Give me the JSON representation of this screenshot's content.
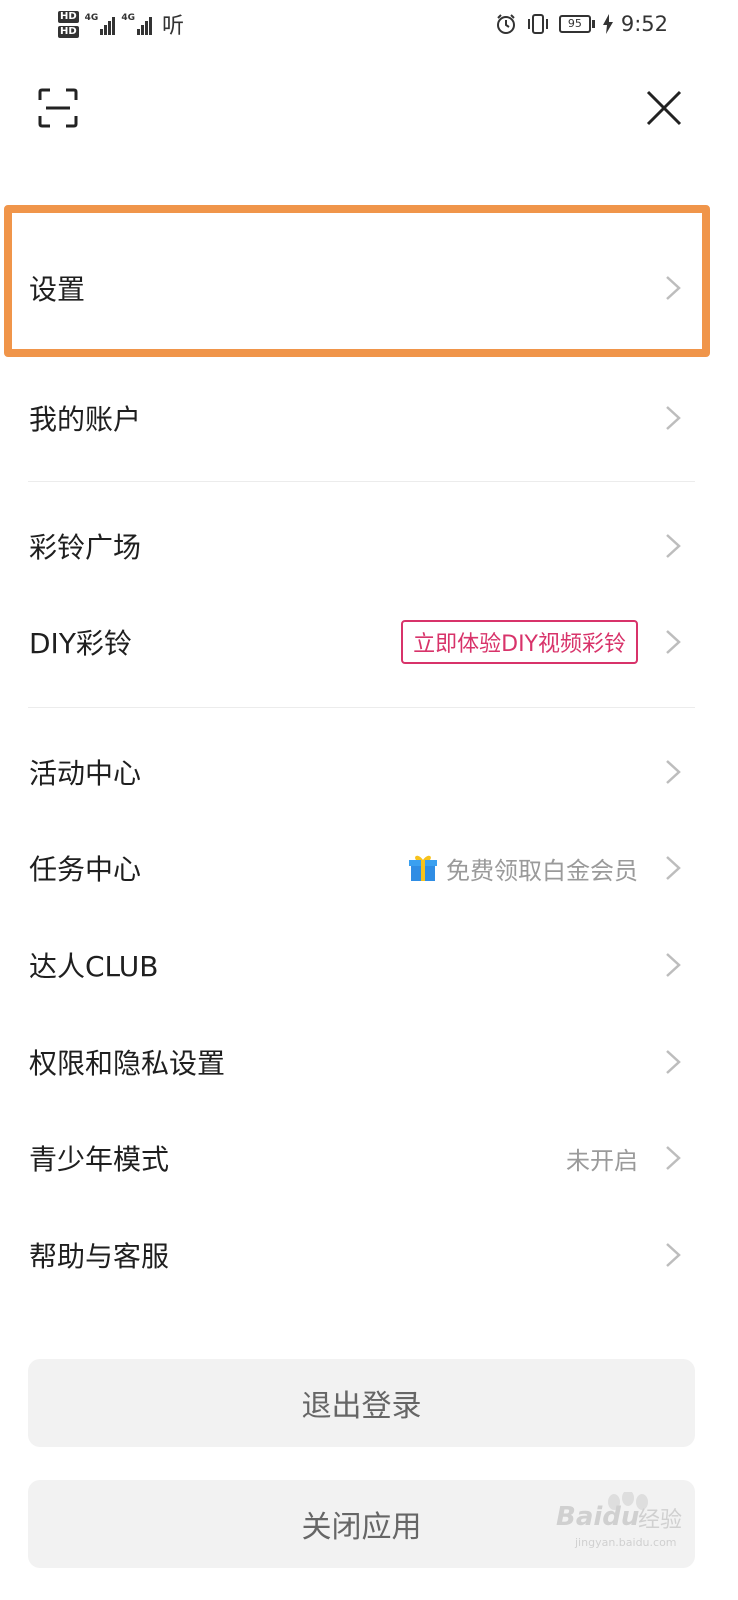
{
  "status_bar": {
    "hd1": "HD",
    "hd2": "HD",
    "net1": "4G",
    "net2": "4G",
    "app_indicator": "听",
    "battery": "95",
    "time": "9:52",
    "icons": [
      "alarm-icon",
      "vibrate-icon",
      "battery-icon",
      "charging-icon"
    ]
  },
  "toolbar": {
    "scan_icon": "scan-icon",
    "close_icon": "close-icon"
  },
  "menu": {
    "settings": "设置",
    "account": "我的账户",
    "plaza": "彩铃广场",
    "diy": "DIY彩铃",
    "diy_badge": "立即体验DIY视频彩铃",
    "activity": "活动中心",
    "task": "任务中心",
    "task_promo": "免费领取白金会员",
    "club": "达人CLUB",
    "privacy": "权限和隐私设置",
    "youth": "青少年模式",
    "youth_value": "未开启",
    "help": "帮助与客服"
  },
  "buttons": {
    "logout": "退出登录",
    "close_app": "关闭应用"
  },
  "watermark": {
    "brand": "Baidu",
    "cn": "经验",
    "url": "jingyan.baidu.com"
  },
  "colors": {
    "highlight": "#f0954a",
    "badge": "#d8336a"
  }
}
